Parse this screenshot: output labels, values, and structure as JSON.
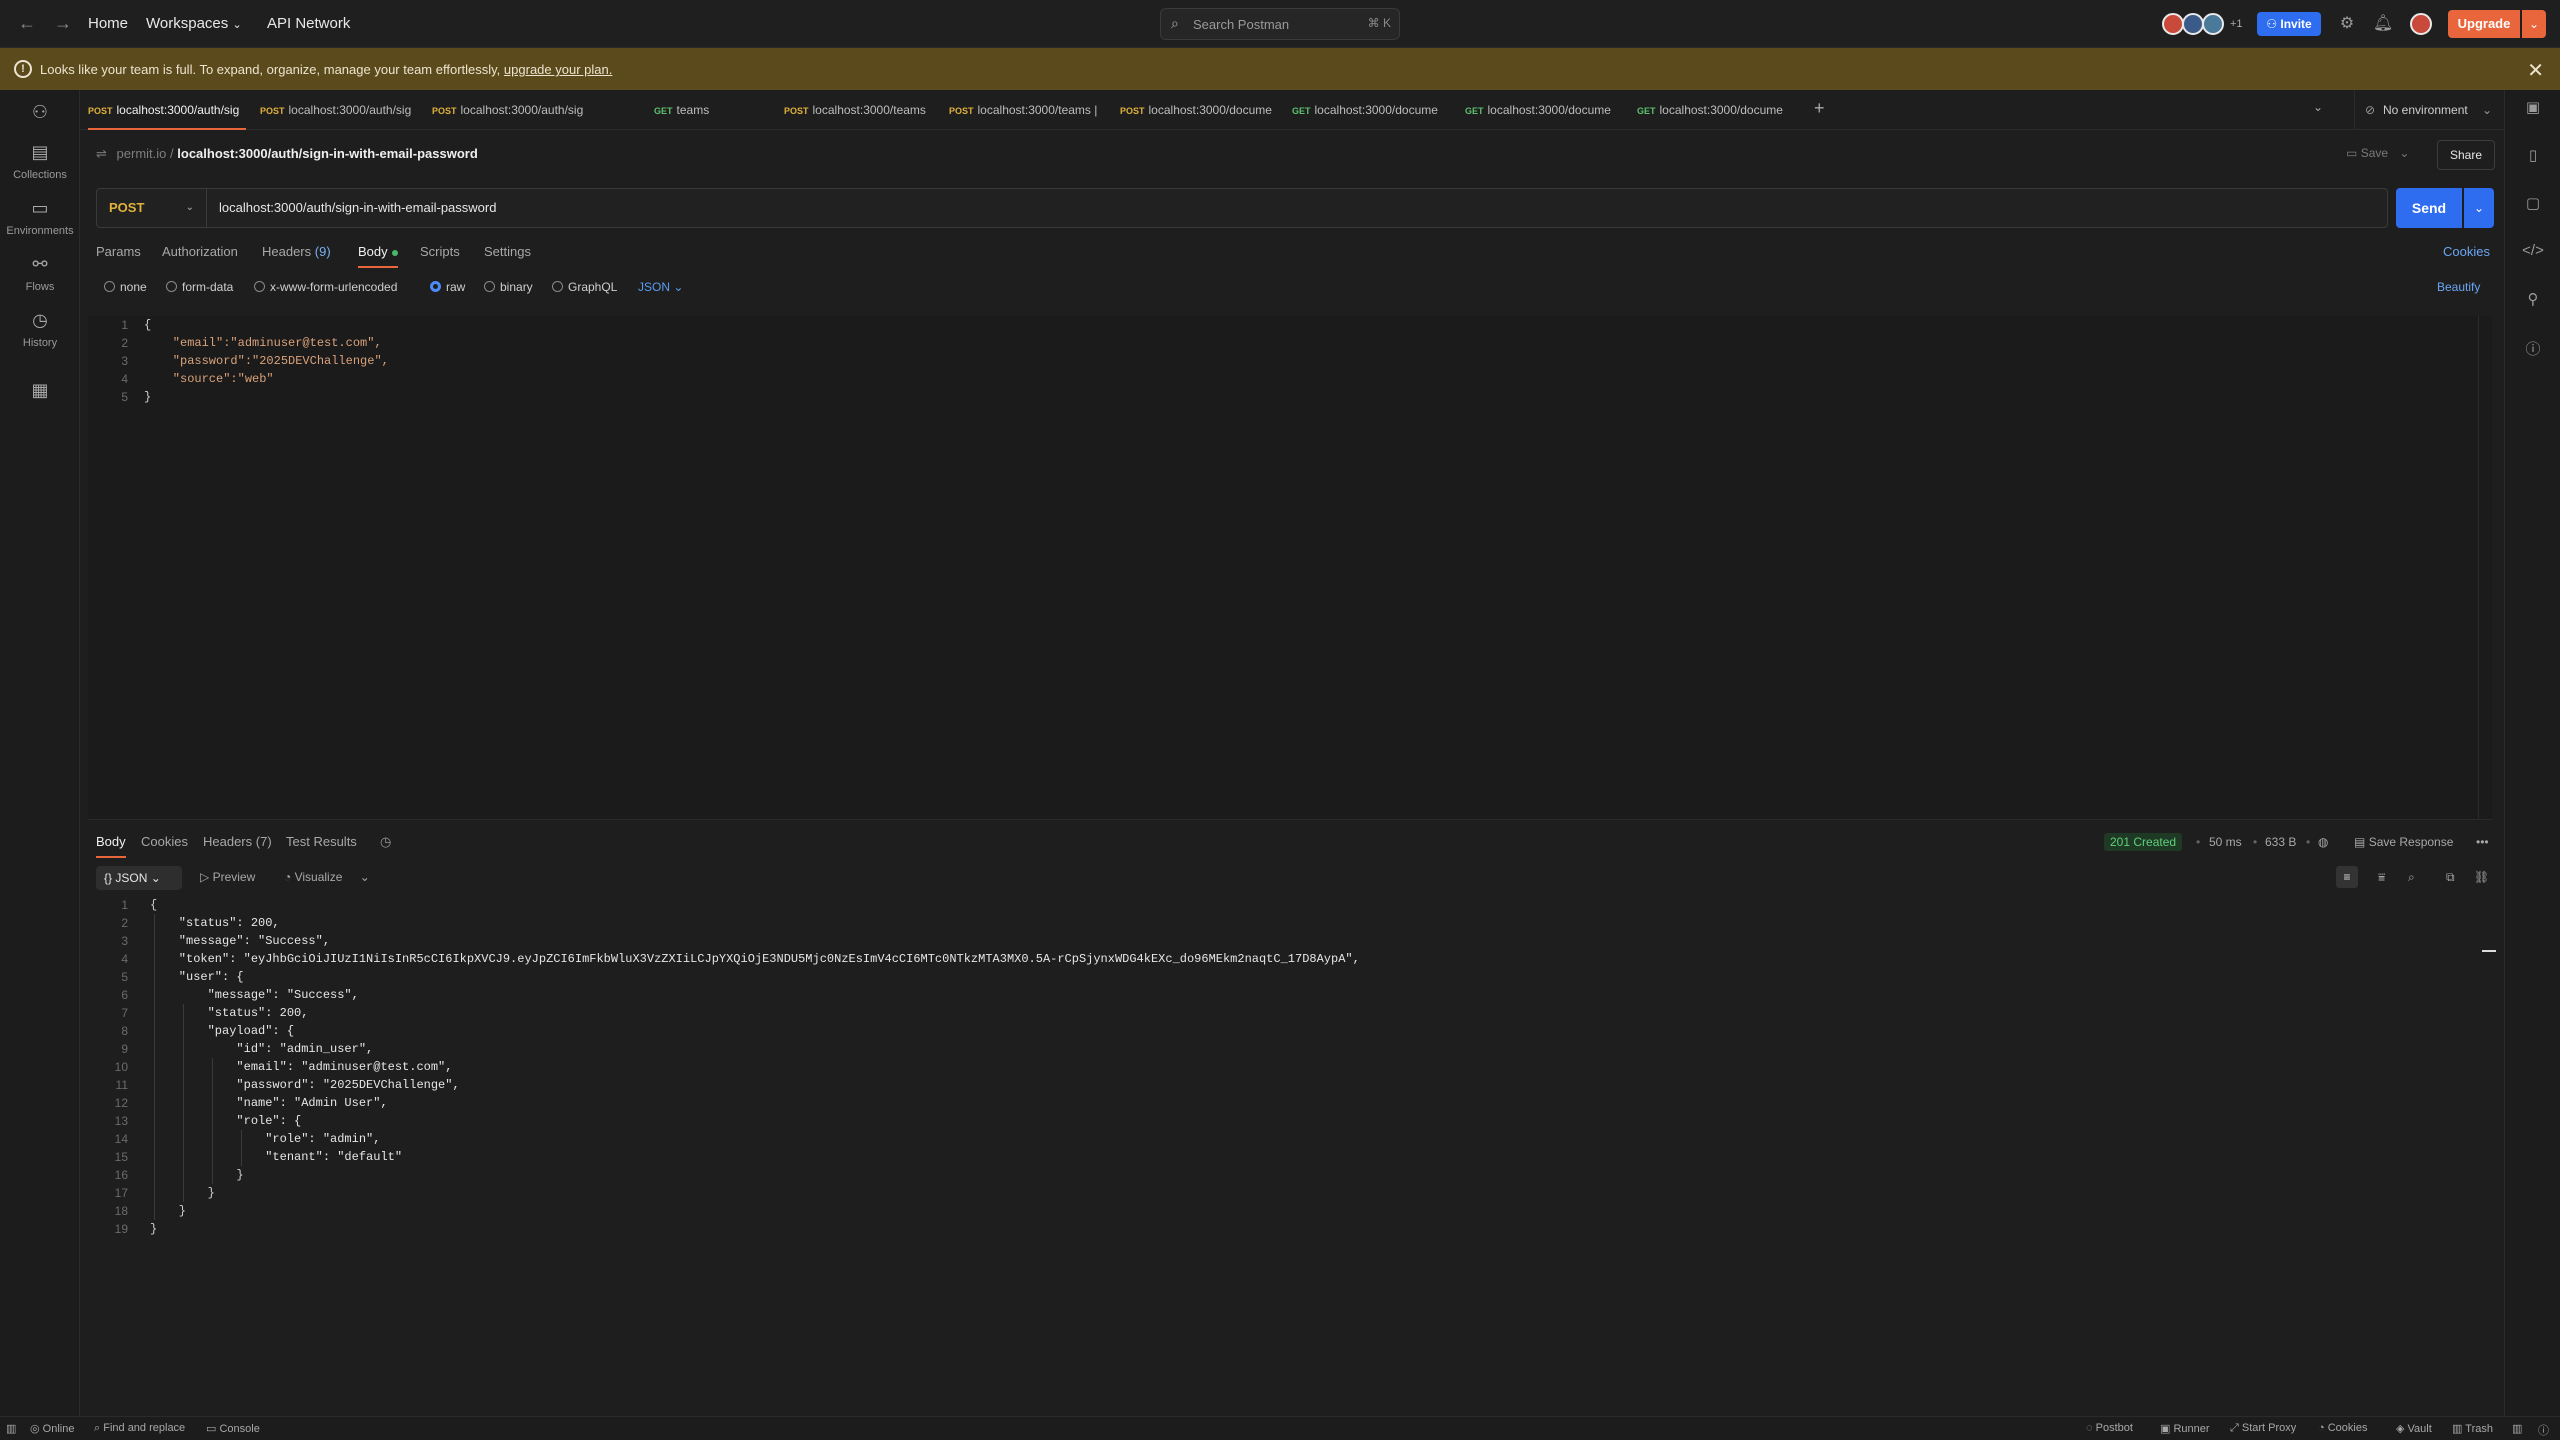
{
  "topbar": {
    "nav": [
      "Home",
      "Workspaces",
      "API Network"
    ],
    "search_placeholder": "Search Postman",
    "search_shortcut": "⌘ K",
    "extra_members": "+1",
    "invite_label": "Invite",
    "upgrade_label": "Upgrade"
  },
  "banner": {
    "message": "Looks like your team is full. To expand, organize, manage your team effortlessly,",
    "link": "upgrade your plan."
  },
  "sidebar": {
    "items": [
      "Collections",
      "Environments",
      "Flows",
      "History"
    ]
  },
  "tabs": [
    {
      "method": "POST",
      "label": "localhost:3000/auth/sig"
    },
    {
      "method": "POST",
      "label": "localhost:3000/auth/sig"
    },
    {
      "method": "POST",
      "label": "localhost:3000/auth/sig"
    },
    {
      "method": "GET",
      "label": "teams"
    },
    {
      "method": "POST",
      "label": "localhost:3000/teams"
    },
    {
      "method": "POST",
      "label": "localhost:3000/teams |"
    },
    {
      "method": "POST",
      "label": "localhost:3000/docume"
    },
    {
      "method": "GET",
      "label": "localhost:3000/docume"
    },
    {
      "method": "GET",
      "label": "localhost:3000/docume"
    },
    {
      "method": "GET",
      "label": "localhost:3000/docume"
    }
  ],
  "environment": "No environment",
  "breadcrumb": {
    "workspace": "permit.io",
    "separator": "/",
    "current": "localhost:3000/auth/sign-in-with-email-password"
  },
  "save_label": "Save",
  "share_label": "Share",
  "request": {
    "method": "POST",
    "url": "localhost:3000/auth/sign-in-with-email-password",
    "send_label": "Send",
    "tabs": {
      "params": "Params",
      "authorization": "Authorization",
      "headers": "Headers",
      "headers_count": "(9)",
      "body": "Body",
      "scripts": "Scripts",
      "settings": "Settings"
    },
    "cookies_label": "Cookies",
    "body_types": [
      "none",
      "form-data",
      "x-www-form-urlencoded",
      "raw",
      "binary",
      "GraphQL"
    ],
    "body_format": "JSON",
    "beautify_label": "Beautify",
    "body_lines": [
      "{",
      "    \"email\":\"adminuser@test.com\",",
      "    \"password\":\"2025DEVChallenge\",",
      "    \"source\":\"web\"",
      "}"
    ]
  },
  "response": {
    "tabs": {
      "body": "Body",
      "cookies": "Cookies",
      "headers": "Headers",
      "headers_count": "(7)",
      "test_results": "Test Results"
    },
    "status": "201 Created",
    "time": "50 ms",
    "size": "633 B",
    "save_response": "Save Response",
    "format": "JSON",
    "preview": "Preview",
    "visualize": "Visualize",
    "lines": [
      "{",
      "    \"status\": 200,",
      "    \"message\": \"Success\",",
      "    \"token\": \"eyJhbGciOiJIUzI1NiIsInR5cCI6IkpXVCJ9.eyJpZCI6ImFkbWluX3VzZXIiLCJpYXQiOjE3NDU5Mjc0NzEsImV4cCI6MTc0NTkzMTA3MX0.5A-rCpSjynxWDG4kEXc_do96MEkm2naqtC_17D8AypA\",",
      "    \"user\": {",
      "        \"message\": \"Success\",",
      "        \"status\": 200,",
      "        \"payload\": {",
      "            \"id\": \"admin_user\",",
      "            \"email\": \"adminuser@test.com\",",
      "            \"password\": \"2025DEVChallenge\",",
      "            \"name\": \"Admin User\",",
      "            \"role\": {",
      "                \"role\": \"admin\",",
      "                \"tenant\": \"default\"",
      "            }",
      "        }",
      "    }",
      "}"
    ]
  },
  "statusbar": {
    "left": [
      "Online",
      "Find and replace",
      "Console"
    ],
    "right": [
      "Postbot",
      "Runner",
      "Start Proxy",
      "Cookies",
      "Vault",
      "Trash"
    ]
  },
  "colors": {
    "accent": "#e9653b",
    "send": "#2f6df0",
    "post": "#e0b23b",
    "get": "#5fbf6f",
    "banner": "#5b4a1c"
  }
}
